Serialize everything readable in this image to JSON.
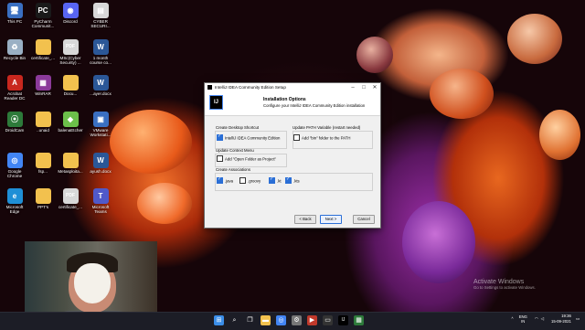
{
  "desktop_icons": [
    {
      "label": "This PC",
      "icon": "this-pc-icon",
      "color": "#3a6fc1",
      "glyph": "🖥"
    },
    {
      "label": "PyCharm\nCommunit...",
      "icon": "pycharm-icon",
      "color": "#1a1a1a",
      "glyph": "PC"
    },
    {
      "label": "Discord",
      "icon": "discord-icon",
      "color": "#5865f2",
      "glyph": "◉"
    },
    {
      "label": "CYBER\nSECURI...",
      "icon": "pdf-icon",
      "color": "#d8d8d8",
      "glyph": "▤"
    },
    {
      "label": "Recycle Bin",
      "icon": "recycle-bin-icon",
      "color": "#9ab0c4",
      "glyph": "♻"
    },
    {
      "label": "certificate_...",
      "icon": "folder-icon",
      "color": "#f2c14e",
      "glyph": ""
    },
    {
      "label": "MSc(Cyber\nSecurity) ...",
      "icon": "pdf-icon",
      "color": "#d8d8d8",
      "glyph": "PDF"
    },
    {
      "label": "1 month\ncourse co...",
      "icon": "word-doc-icon",
      "color": "#2b5797",
      "glyph": "W"
    },
    {
      "label": "Acrobat\nReader DC",
      "icon": "acrobat-icon",
      "color": "#c8271e",
      "glyph": "A"
    },
    {
      "label": "WinRAR",
      "icon": "winrar-icon",
      "color": "#8b3a9a",
      "glyph": "▦"
    },
    {
      "label": "Docu...",
      "icon": "folder-icon",
      "color": "#f2c14e",
      "glyph": ""
    },
    {
      "label": "...ayer.docx",
      "icon": "word-doc-icon",
      "color": "#2b5797",
      "glyph": "W"
    },
    {
      "label": "DroidCam",
      "icon": "droidcam-icon",
      "color": "#2d7a3a",
      "glyph": "⦿"
    },
    {
      "label": "..unaid",
      "icon": "folder-icon",
      "color": "#f2c14e",
      "glyph": ""
    },
    {
      "label": "balenaEtcher",
      "icon": "balena-etcher-icon",
      "color": "#6cc04a",
      "glyph": "◆"
    },
    {
      "label": "VMware\nWorkstati...",
      "icon": "vmware-icon",
      "color": "#3a6fc1",
      "glyph": "▣"
    },
    {
      "label": "Google\nChrome",
      "icon": "chrome-icon",
      "color": "#4285f4",
      "glyph": "◎"
    },
    {
      "label": "fsp...",
      "icon": "folder-icon",
      "color": "#f2c14e",
      "glyph": ""
    },
    {
      "label": "Metasploita...",
      "icon": "folder-icon",
      "color": "#f2c14e",
      "glyph": ""
    },
    {
      "label": "ayush.docx",
      "icon": "word-doc-icon",
      "color": "#2b5797",
      "glyph": "W"
    },
    {
      "label": "Microsoft\nEdge",
      "icon": "edge-icon",
      "color": "#1f8fd6",
      "glyph": "e"
    },
    {
      "label": "PPT's",
      "icon": "folder-icon",
      "color": "#f2c14e",
      "glyph": ""
    },
    {
      "label": "certificate_...",
      "icon": "pdf-icon",
      "color": "#d8d8d8",
      "glyph": "PDF"
    },
    {
      "label": "Microsoft\nTeams",
      "icon": "teams-icon",
      "color": "#5059c9",
      "glyph": "T"
    }
  ],
  "dialog": {
    "title": "IntelliJ IDEA Community Edition Setup",
    "logo_text": "IJ",
    "heading": "Installation Options",
    "subheading": "Configure your IntelliJ IDEA Community Edition installation",
    "create_shortcut": {
      "label": "Create Desktop Shortcut",
      "option": "IntelliJ IDEA Community Edition",
      "checked": true
    },
    "update_path": {
      "label": "Update PATH Variable (restart needed)",
      "option": "Add \"bin\" folder to the PATH",
      "checked": false
    },
    "context_menu": {
      "label": "Update Context Menu",
      "option": "Add \"Open Folder as Project\"",
      "checked": false
    },
    "associations": {
      "label": "Create Associations",
      "options": [
        {
          "label": ".java",
          "checked": true
        },
        {
          "label": ".groovy",
          "checked": false
        },
        {
          "label": ".kt",
          "checked": true
        },
        {
          "label": ".kts",
          "checked": true
        }
      ]
    },
    "buttons": {
      "back": "< Back",
      "next": "Next >",
      "cancel": "Cancel"
    }
  },
  "watermark": {
    "line1": "Activate Windows",
    "line2": "Go to Settings to activate Windows."
  },
  "tray": {
    "language": "ENG",
    "region": "IN",
    "time": "19:36",
    "date": "15-09-2021"
  },
  "taskbar_icons": [
    {
      "name": "start-icon",
      "color": "#3b8ee8",
      "glyph": "⊞"
    },
    {
      "name": "search-icon",
      "color": "#1c1d26",
      "glyph": "⌕"
    },
    {
      "name": "task-view-icon",
      "color": "#1c1d26",
      "glyph": "❐"
    },
    {
      "name": "file-explorer-icon",
      "color": "#f2c14e",
      "glyph": "▬"
    },
    {
      "name": "chrome-icon",
      "color": "#4285f4",
      "glyph": "◎"
    },
    {
      "name": "settings-icon",
      "color": "#777",
      "glyph": "⚙"
    },
    {
      "name": "media-icon",
      "color": "#c0392b",
      "glyph": "▶"
    },
    {
      "name": "terminal-icon",
      "color": "#333",
      "glyph": "▭"
    },
    {
      "name": "intellij-icon",
      "color": "#000",
      "glyph": "IJ"
    },
    {
      "name": "app-icon",
      "color": "#2d7a3a",
      "glyph": "▦"
    }
  ]
}
